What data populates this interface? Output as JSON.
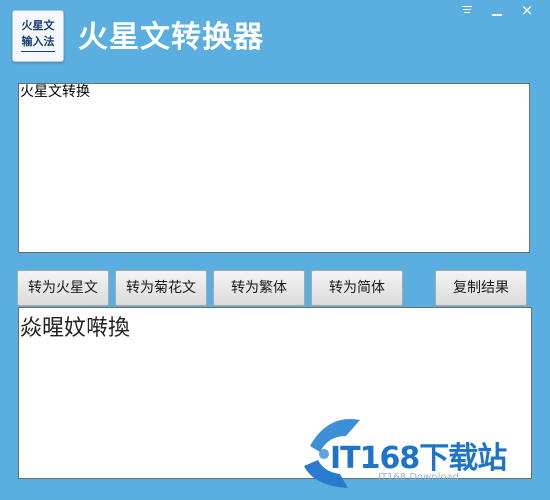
{
  "app": {
    "logo_line1": "火星文",
    "logo_line2": "输入法",
    "title": "火星文转换器"
  },
  "window_controls": {
    "minimize": "-",
    "close": "×"
  },
  "input": {
    "value": "火星文转换"
  },
  "buttons": {
    "to_martian": "转为火星文",
    "to_juhua": "转为菊花文",
    "to_traditional": "转为繁体",
    "to_simplified": "转为简体",
    "copy_result": "复制结果"
  },
  "output": {
    "value": "焱暒妏啭換"
  },
  "watermark": {
    "brand": "IT168下载站",
    "sub": "IT168 Download"
  },
  "colors": {
    "background": "#5aaee0",
    "watermark": "#1d74c8"
  },
  "icons": {
    "menu": "menu-icon",
    "minimize": "minimize-icon",
    "close": "close-icon"
  }
}
